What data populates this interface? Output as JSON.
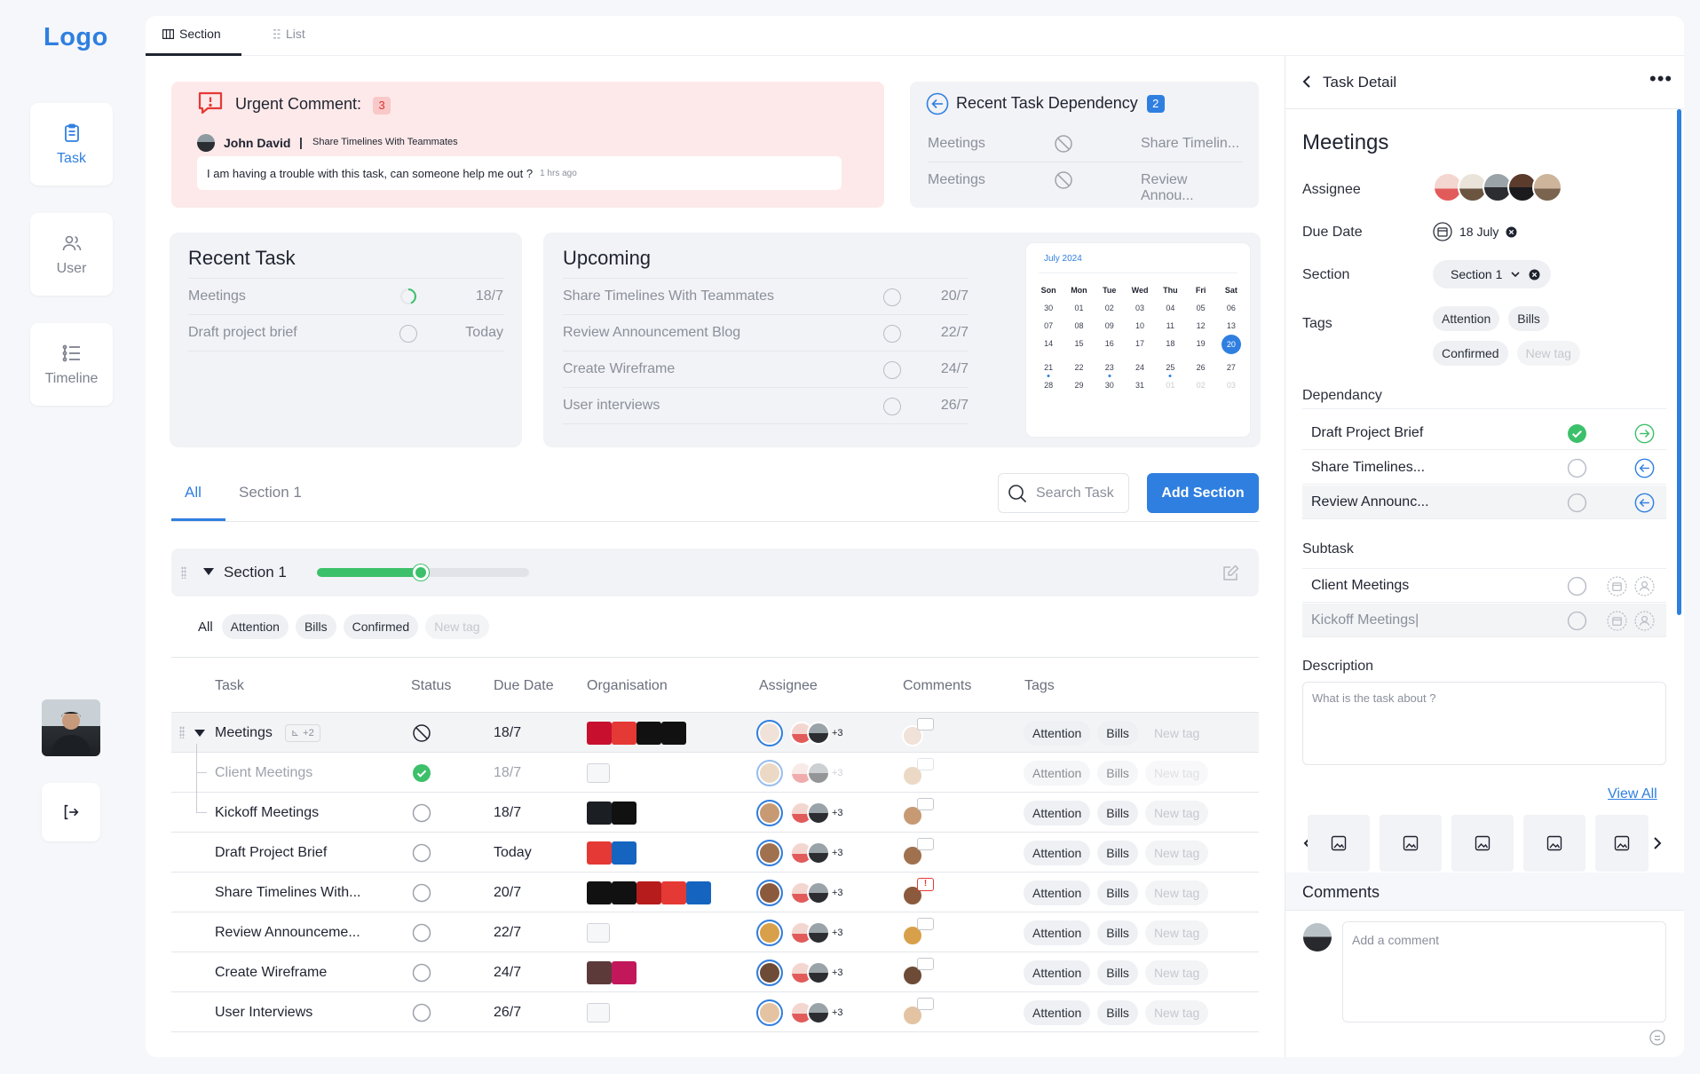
{
  "logo": "Logo",
  "nav": [
    {
      "label": "Task",
      "icon": "clipboard-icon",
      "active": true
    },
    {
      "label": "User",
      "icon": "users-icon",
      "active": false
    },
    {
      "label": "Timeline",
      "icon": "timeline-icon",
      "active": false
    }
  ],
  "view_tabs": {
    "section": "Section",
    "list": "List"
  },
  "urgent": {
    "title": "Urgent Comment:",
    "count": "3",
    "author": "John David",
    "separator": "|",
    "task": "Share Timelines With Teammates",
    "message": "I am having a trouble with this task, can someone help me out ?",
    "time": "1 hrs ago"
  },
  "dependency": {
    "title": "Recent Task Dependency",
    "count": "2",
    "rows": [
      {
        "from": "Meetings",
        "to": "Share Timelin..."
      },
      {
        "from": "Meetings",
        "to": "Review Annou..."
      }
    ]
  },
  "recent_task": {
    "title": "Recent Task",
    "rows": [
      {
        "name": "Meetings",
        "date": "18/7"
      },
      {
        "name": "Draft project brief",
        "date": "Today"
      }
    ]
  },
  "upcoming": {
    "title": "Upcoming",
    "rows": [
      {
        "name": "Share Timelines With Teammates",
        "date": "20/7"
      },
      {
        "name": "Review Announcement Blog",
        "date": "22/7"
      },
      {
        "name": "Create Wireframe",
        "date": "24/7"
      },
      {
        "name": "User interviews",
        "date": "26/7"
      }
    ]
  },
  "calendar": {
    "month": "July 2024",
    "weekdays": [
      "Son",
      "Mon",
      "Tue",
      "Wed",
      "Thu",
      "Fri",
      "Sat"
    ],
    "days": [
      "30",
      "01",
      "02",
      "03",
      "04",
      "05",
      "06",
      "07",
      "08",
      "09",
      "10",
      "11",
      "12",
      "13",
      "14",
      "15",
      "16",
      "17",
      "18",
      "19",
      "20",
      "21",
      "22",
      "23",
      "24",
      "25",
      "26",
      "27",
      "28",
      "29",
      "30",
      "31",
      "01",
      "02",
      "03"
    ],
    "selected": "20"
  },
  "filters": {
    "all": "All",
    "section1": "Section 1",
    "search_placeholder": "Search Task",
    "add_section": "Add Section"
  },
  "section": {
    "title": "Section 1",
    "progress": 0.49
  },
  "tag_filters": [
    "All",
    "Attention",
    "Bills",
    "Confirmed",
    "New tag"
  ],
  "table": {
    "headers": [
      "Task",
      "Status",
      "Due Date",
      "Organisation",
      "Assignee",
      "Comments",
      "Tags"
    ],
    "subtask_count": "+2",
    "assignee_more": "+3",
    "tags": [
      "Attention",
      "Bills",
      "New tag"
    ],
    "rows": [
      {
        "name": "Meetings",
        "due": "18/7",
        "status": "blocked"
      },
      {
        "name": "Client Meetings",
        "due": "18/7",
        "status": "done"
      },
      {
        "name": "Kickoff Meetings",
        "due": "18/7",
        "status": "open"
      },
      {
        "name": "Draft Project Brief",
        "due": "Today",
        "status": "open"
      },
      {
        "name": "Share Timelines With...",
        "due": "20/7",
        "status": "open"
      },
      {
        "name": "Review Announceme...",
        "due": "22/7",
        "status": "open"
      },
      {
        "name": "Create Wireframe",
        "due": "24/7",
        "status": "open"
      },
      {
        "name": "User Interviews",
        "due": "26/7",
        "status": "open"
      }
    ]
  },
  "detail": {
    "header": "Task Detail",
    "title": "Meetings",
    "assignee_label": "Assignee",
    "due_label": "Due Date",
    "due_value": "18 July",
    "section_label": "Section",
    "section_value": "Section 1",
    "tags_label": "Tags",
    "tags": [
      "Attention",
      "Bills",
      "Confirmed",
      "New tag"
    ],
    "dependency_label": "Dependancy",
    "dependencies": [
      "Draft Project Brief",
      "Share Timelines...",
      "Review Announc..."
    ],
    "subtask_label": "Subtask",
    "subtasks": [
      "Client Meetings",
      "Kickoff Meetings|"
    ],
    "description_label": "Description",
    "description_placeholder": "What is the task about ?",
    "view_all": "View All",
    "comments_label": "Comments",
    "comment_placeholder": "Add a comment"
  },
  "colors": {
    "accent": "#2f7fe0",
    "success": "#3cc06a",
    "urgent_bg": "#fde9e9"
  }
}
